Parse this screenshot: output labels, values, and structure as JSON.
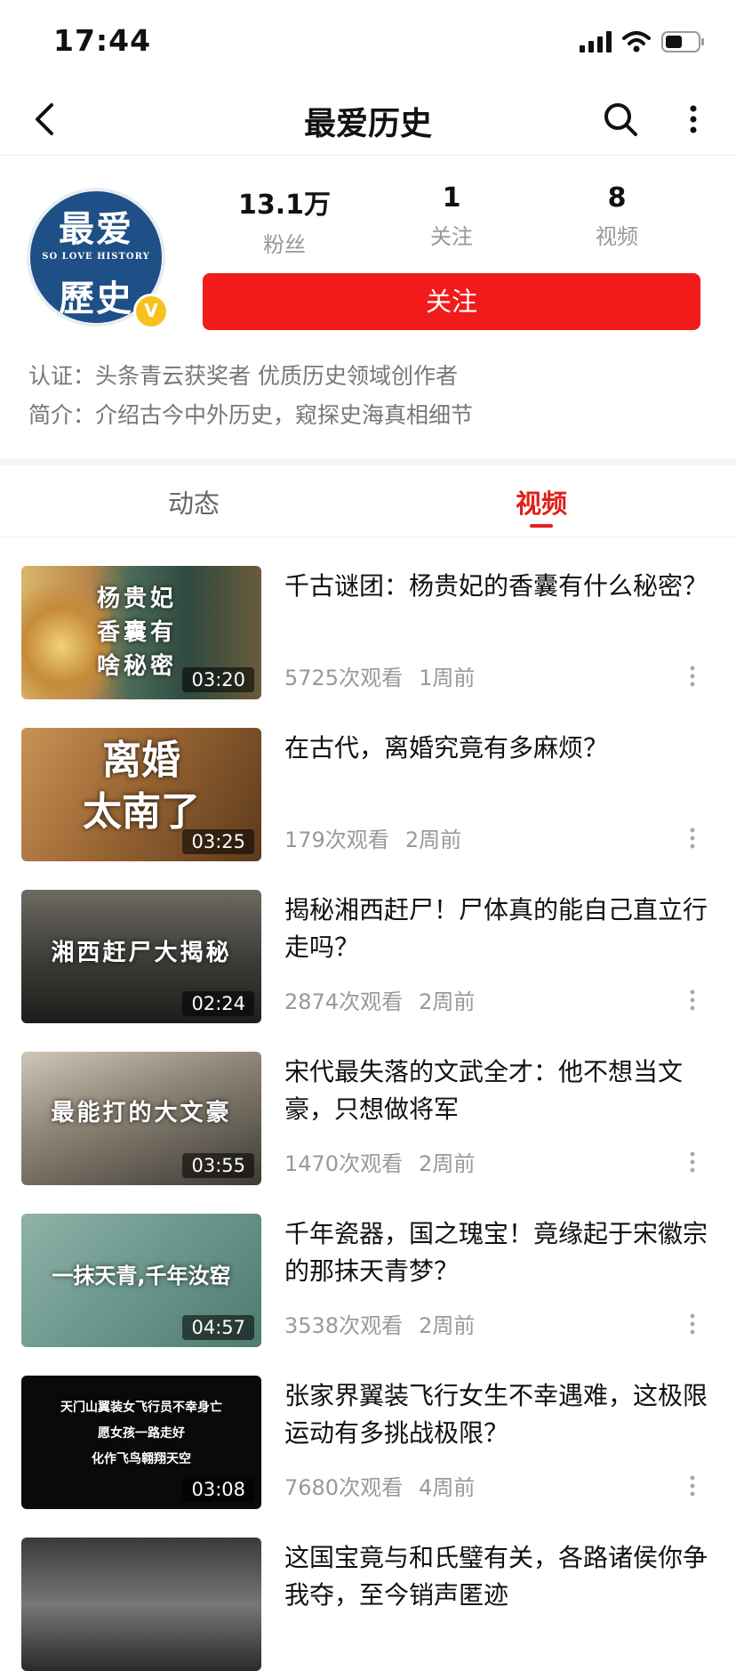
{
  "status": {
    "time": "17:44"
  },
  "nav": {
    "title": "最爱历史"
  },
  "profile": {
    "avatar_top": "最爱",
    "avatar_mid": "SO LOVE HISTORY",
    "avatar_bottom": "歷史",
    "badge": "V",
    "stats": [
      {
        "value": "13.1万",
        "label": "粉丝"
      },
      {
        "value": "1",
        "label": "关注"
      },
      {
        "value": "8",
        "label": "视频"
      }
    ],
    "follow_label": "关注",
    "certification": "认证：头条青云获奖者 优质历史领域创作者",
    "intro": "简介：介绍古今中外历史，窥探史海真相细节"
  },
  "tabs": [
    {
      "label": "动态",
      "active": false
    },
    {
      "label": "视频",
      "active": true
    }
  ],
  "colors": {
    "accent": "#e0201b",
    "follow_button": "#f21b1b"
  },
  "videos": [
    {
      "overlay": "杨贵妃\n香囊有\n啥秘密",
      "duration": "03:20",
      "title": "千古谜团：杨贵妃的香囊有什么秘密？",
      "views": "5725次观看",
      "time": "1周前"
    },
    {
      "overlay": "离婚\n太南了",
      "duration": "03:25",
      "title": "在古代，离婚究竟有多麻烦？",
      "views": "179次观看",
      "time": "2周前"
    },
    {
      "overlay": "湘西赶尸大揭秘",
      "duration": "02:24",
      "title": "揭秘湘西赶尸！尸体真的能自己直立行走吗？",
      "views": "2874次观看",
      "time": "2周前"
    },
    {
      "overlay": "最能打的大文豪",
      "duration": "03:55",
      "title": "宋代最失落的文武全才：他不想当文豪，只想做将军",
      "views": "1470次观看",
      "time": "2周前"
    },
    {
      "overlay": "一抹天青,千年汝窑",
      "duration": "04:57",
      "title": "千年瓷器，国之瑰宝！竟缘起于宋徽宗的那抹天青梦？",
      "views": "3538次观看",
      "time": "2周前"
    },
    {
      "overlay": "天门山翼装女飞行员不幸身亡\n愿女孩一路走好\n化作飞鸟翱翔天空",
      "duration": "03:08",
      "title": "张家界翼装飞行女生不幸遇难，这极限运动有多挑战极限？",
      "views": "7680次观看",
      "time": "4周前"
    },
    {
      "overlay": "",
      "duration": "",
      "title": "这国宝竟与和氏璧有关，各路诸侯你争我夺，至今销声匿迹",
      "views": "",
      "time": ""
    }
  ]
}
